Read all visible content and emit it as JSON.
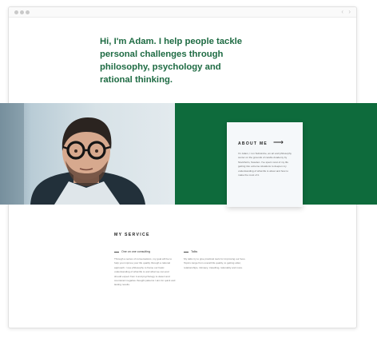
{
  "hero": {
    "heading": "Hi, I'm Adam. I help people tackle personal challenges through philosophy, psychology and rational thinking."
  },
  "about": {
    "title": "ABOUT ME",
    "text": "I'm Adam, I run Substrobe, an art and philosophy center on the grounds of candle Academy by Stockholm, Sweden. I've spent most of my life getting into extreme situations to deepen my understanding of what life is about and how to make the most of it."
  },
  "service": {
    "title": "MY SERVICE",
    "columns": [
      {
        "label": "One on one consulting",
        "text": "Through a series of conversations, my goal will be to help you improve your life quality through a rational approach. I use philosophy to frame our basic understanding of what life is and what we can and should expect from it and psychology to detect and counteract negative thought patterns I aim for quick and lasting results."
      },
      {
        "label": "Talks",
        "text": "My talks try to give practical tools for improving our lives. Topics range from overall life quality, to getting older, relationships, intimacy, travelling, rationality and more."
      }
    ]
  },
  "icons": [
    "window-dot-icon",
    "back-arrow-icon",
    "forward-arrow-icon",
    "right-arrow-icon"
  ],
  "colors": {
    "brand_green": "#0e6b3c",
    "heading_green": "#1e6b43",
    "card_bg": "#f5f8fa"
  }
}
